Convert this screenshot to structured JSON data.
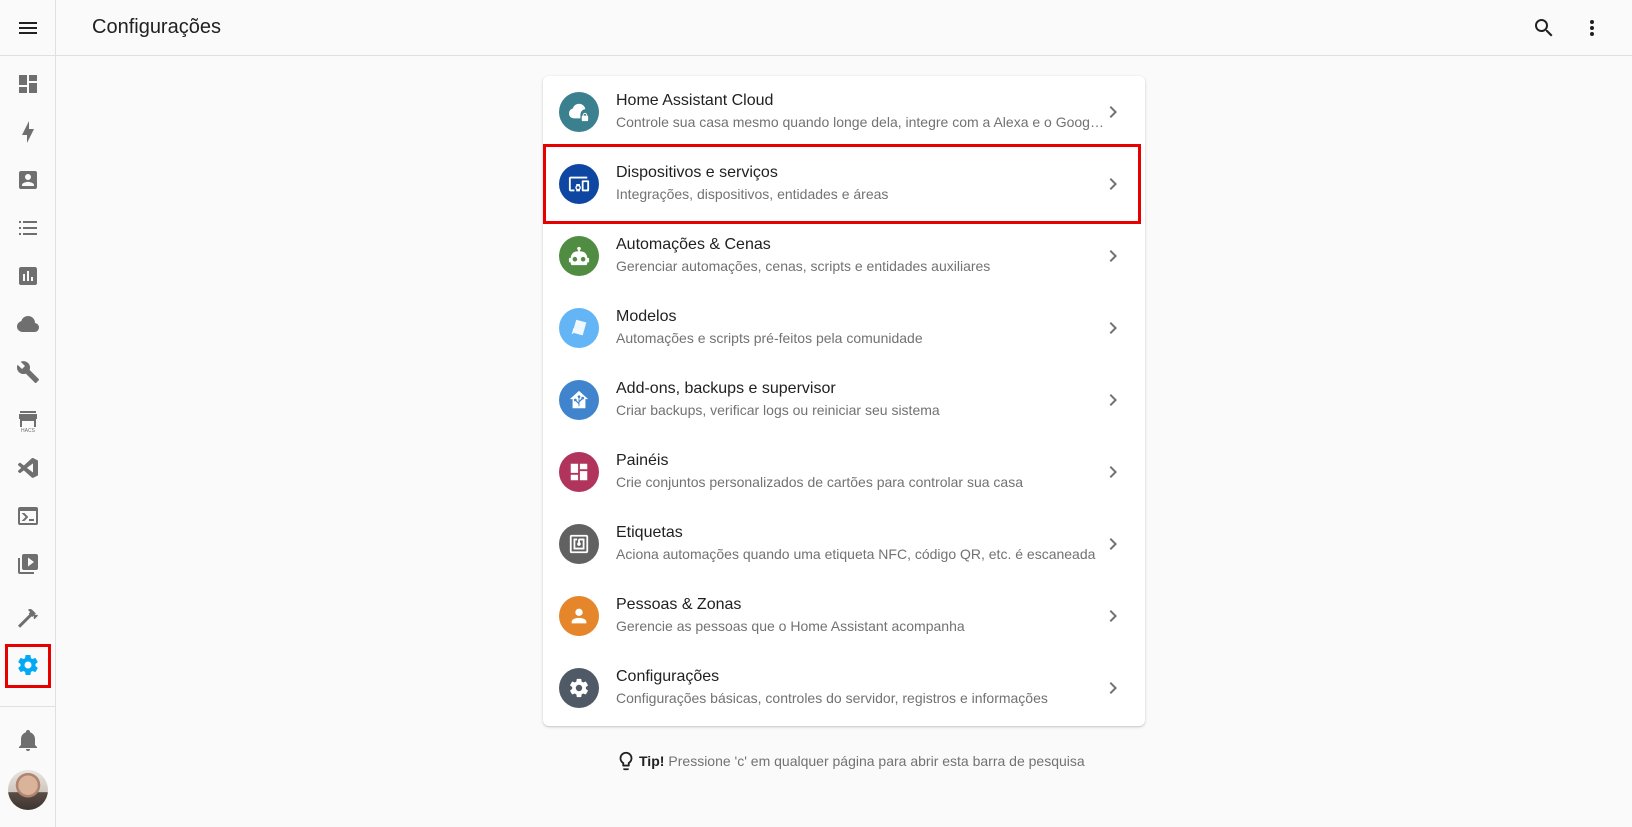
{
  "header": {
    "title": "Configurações"
  },
  "sidebar": {
    "items": [
      {
        "name": "overview",
        "icon": "view-dashboard-icon"
      },
      {
        "name": "energy",
        "icon": "lightning-bolt-icon"
      },
      {
        "name": "logbook",
        "icon": "account-box-icon"
      },
      {
        "name": "todo",
        "icon": "format-list-checks-icon"
      },
      {
        "name": "history",
        "icon": "chart-box-icon"
      },
      {
        "name": "cloud",
        "icon": "cloud-icon"
      },
      {
        "name": "tools",
        "icon": "wrench-icon"
      },
      {
        "name": "hacs",
        "icon": "store-icon",
        "label": "HACS"
      },
      {
        "name": "vscode",
        "icon": "vscode-icon"
      },
      {
        "name": "terminal",
        "icon": "console-icon"
      },
      {
        "name": "media",
        "icon": "play-box-multiple-icon"
      },
      {
        "name": "developer-tools",
        "icon": "hammer-icon"
      },
      {
        "name": "settings",
        "icon": "cog-icon",
        "active": true
      }
    ],
    "notifications_icon": "bell-icon"
  },
  "settings_list": [
    {
      "title": "Home Assistant Cloud",
      "desc": "Controle sua casa mesmo quando longe dela, integre com a Alexa e o Google Assistente",
      "color": "#3b808e",
      "icon": "cloud-lock-icon"
    },
    {
      "title": "Dispositivos e serviços",
      "desc": "Integrações, dispositivos, entidades e áreas",
      "color": "#0d47a1",
      "icon": "devices-icon"
    },
    {
      "title": "Automações & Cenas",
      "desc": "Gerenciar automações, cenas, scripts e entidades auxiliares",
      "color": "#518c43",
      "icon": "robot-icon"
    },
    {
      "title": "Modelos",
      "desc": "Automações e scripts pré-feitos pela comunidade",
      "color": "#64b5f6",
      "icon": "blueprint-icon"
    },
    {
      "title": "Add-ons, backups e supervisor",
      "desc": "Criar backups, verificar logs ou reiniciar seu sistema",
      "color": "#4084cd",
      "icon": "home-assistant-icon"
    },
    {
      "title": "Painéis",
      "desc": "Crie conjuntos personalizados de cartões para controlar sua casa",
      "color": "#b1345c",
      "icon": "view-dashboard-icon"
    },
    {
      "title": "Etiquetas",
      "desc": "Aciona automações quando uma etiqueta NFC, código QR, etc. é escaneada",
      "color": "#616161",
      "icon": "nfc-variant-icon"
    },
    {
      "title": "Pessoas & Zonas",
      "desc": "Gerencie as pessoas que o Home Assistant acompanha",
      "color": "#e48629",
      "icon": "account-icon"
    },
    {
      "title": "Configurações",
      "desc": "Configurações básicas, controles do servidor, registros e informações",
      "color": "#4f5a66",
      "icon": "cog-icon"
    }
  ],
  "tip": {
    "label": "Tip!",
    "text": "Pressione 'c' em qualquer página para abrir esta barra de pesquisa"
  }
}
